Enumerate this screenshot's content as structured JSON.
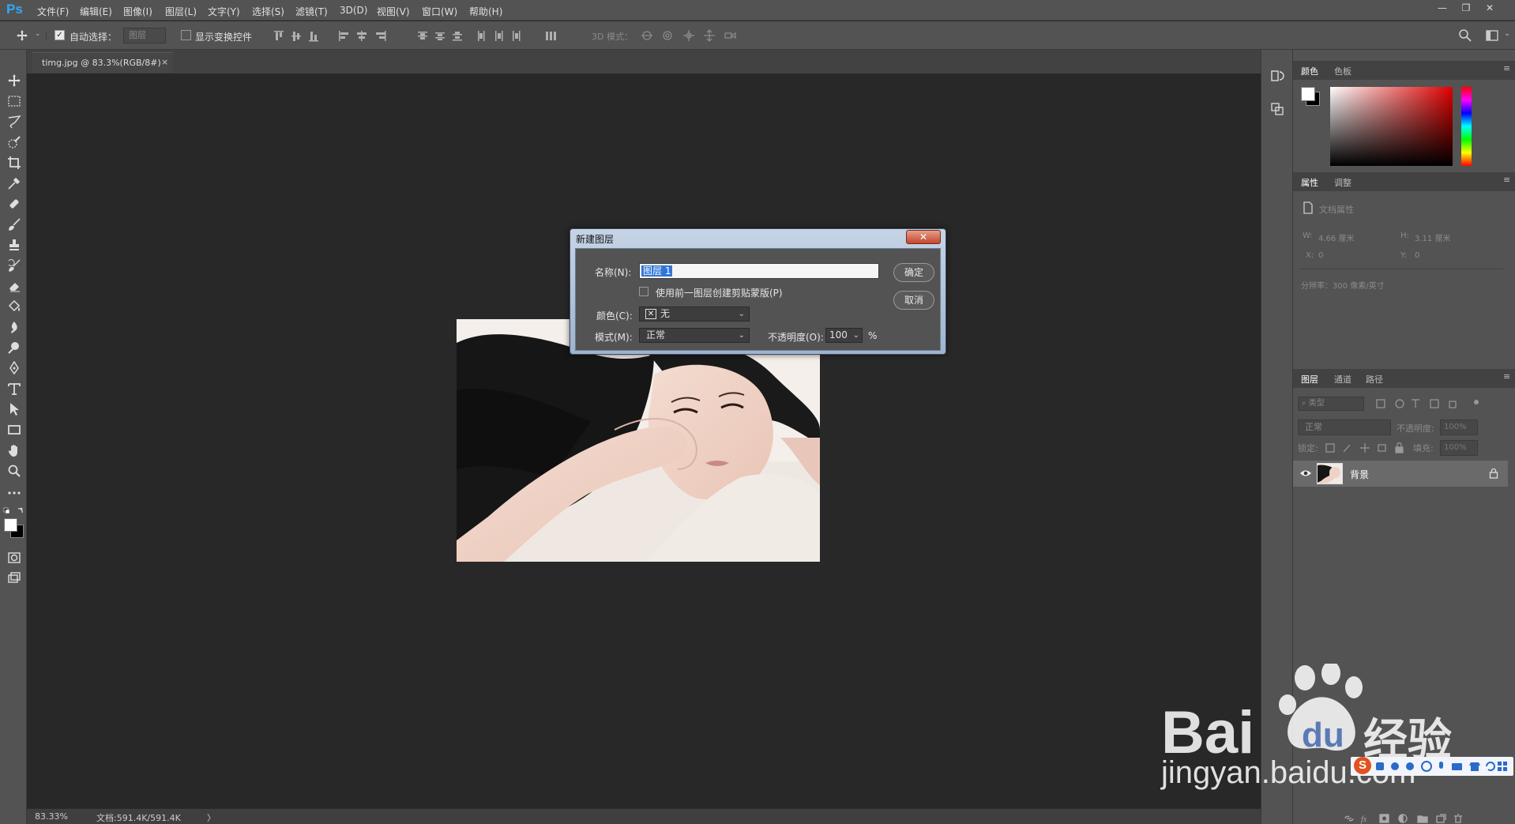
{
  "app": {
    "logo": "Ps"
  },
  "menu": {
    "items": [
      "文件(F)",
      "编辑(E)",
      "图像(I)",
      "图层(L)",
      "文字(Y)",
      "选择(S)",
      "滤镜(T)",
      "3D(D)",
      "视图(V)",
      "窗口(W)",
      "帮助(H)"
    ]
  },
  "options": {
    "auto_select_label": "自动选择：",
    "auto_select_value": "图层",
    "show_transform_label": "显示变换控件",
    "mode_3d_label": "3D 模式："
  },
  "document": {
    "tab_title": "timg.jpg @ 83.3%(RGB/8#)",
    "close_symbol": "×"
  },
  "status": {
    "zoom": "83.33%",
    "doc_size": "文档:591.4K/591.4K",
    "arrow": "〉"
  },
  "dialog": {
    "title": "新建图层",
    "name_label": "名称(N):",
    "name_value": "图层 1",
    "clip_label": "使用前一图层创建剪贴蒙版(P)",
    "color_label": "颜色(C):",
    "color_value": "无",
    "mode_label": "模式(M):",
    "mode_value": "正常",
    "opacity_label": "不透明度(O):",
    "opacity_value": "100",
    "opacity_unit": "%",
    "ok_label": "确定",
    "cancel_label": "取消"
  },
  "color_panel": {
    "tabs": [
      "颜色",
      "色板"
    ]
  },
  "properties_panel": {
    "tabs": [
      "属性",
      "调整"
    ],
    "doc_props_label": "文档属性",
    "w_label": "W:",
    "w_value": "4.66 厘米",
    "h_label": "H:",
    "h_value": "3.11 厘米",
    "x_label": "X:",
    "x_value": "0",
    "y_label": "Y:",
    "y_value": "0",
    "resolution": "分辨率：300 像素/英寸"
  },
  "layers_panel": {
    "tabs": [
      "图层",
      "通道",
      "路径"
    ],
    "filter_placeholder": "类型",
    "blend_mode": "正常",
    "opacity_label": "不透明度:",
    "opacity_value": "100%",
    "lock_label": "锁定:",
    "fill_label": "填充:",
    "fill_value": "100%",
    "layer_name": "背景"
  },
  "watermark": {
    "brand": "Bai",
    "brand2": "du",
    "cn": "经验",
    "url": "jingyan.baidu.com"
  },
  "colors": {
    "ps_blue": "#31a8ff",
    "panel_bg": "#535353",
    "canvas_bg": "#282828"
  }
}
